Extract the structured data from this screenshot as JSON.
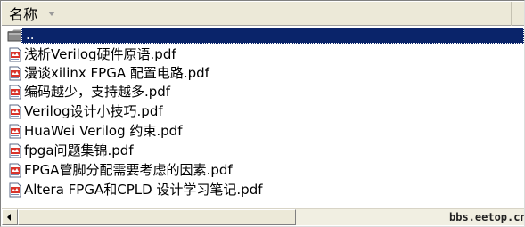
{
  "header": {
    "name_column": "名称"
  },
  "files": [
    {
      "name": "..",
      "icon": "folder-icon",
      "selected": true
    },
    {
      "name": "浅析Verilog硬件原语.pdf",
      "icon": "pdf-file-icon"
    },
    {
      "name": "漫谈xilinx FPGA 配置电路.pdf",
      "icon": "pdf-file-icon"
    },
    {
      "name": "编码越少，支持越多.pdf",
      "icon": "pdf-file-icon"
    },
    {
      "name": "Verilog设计小技巧.pdf",
      "icon": "pdf-file-icon"
    },
    {
      "name": "HuaWei Verilog 约束.pdf",
      "icon": "pdf-file-icon"
    },
    {
      "name": "fpga问题集锦.pdf",
      "icon": "pdf-file-icon"
    },
    {
      "name": "FPGA管脚分配需要考虑的因素.pdf",
      "icon": "pdf-file-icon"
    },
    {
      "name": "Altera FPGA和CPLD 设计学习笔记.pdf",
      "icon": "pdf-file-icon"
    }
  ],
  "watermark": "bbs.eetop.cn",
  "colors": {
    "selection": "#0a246a",
    "header_bg": "#ece9d8"
  }
}
